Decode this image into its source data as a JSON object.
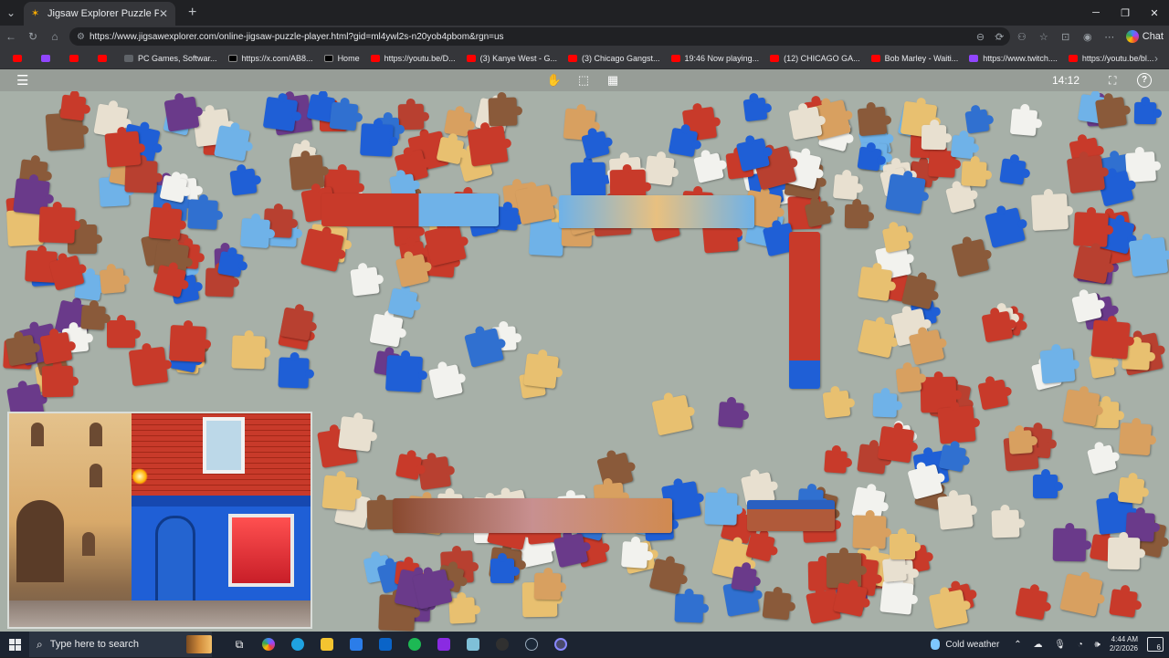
{
  "browser": {
    "tab": {
      "title": "Jigsaw Explorer Puzzle Player",
      "favicon": "puzzle-piece-icon"
    },
    "new_tab": "+",
    "window_controls": [
      "minimize-icon",
      "restore-icon",
      "close-icon"
    ],
    "address": {
      "url": "https://www.jigsawexplorer.com/online-jigsaw-puzzle-player.html?gid=ml4ywl2s-n20yob4pbom&rgn=us",
      "chat_label": "Chat"
    },
    "bookmarks": [
      {
        "label": "",
        "icon": "youtube"
      },
      {
        "label": "",
        "icon": "twitch"
      },
      {
        "label": "",
        "icon": "youtube"
      },
      {
        "label": "",
        "icon": "youtube"
      },
      {
        "label": "PC Games, Softwar...",
        "icon": "generic"
      },
      {
        "label": "https://x.com/AB8...",
        "icon": "x"
      },
      {
        "label": "Home",
        "icon": "x"
      },
      {
        "label": "https://youtu.be/D...",
        "icon": "youtube"
      },
      {
        "label": "(3) Kanye West - G...",
        "icon": "youtube"
      },
      {
        "label": "(3) Chicago Gangst...",
        "icon": "youtube"
      },
      {
        "label": "19:46 Now playing...",
        "icon": "youtube"
      },
      {
        "label": "(12) CHICAGO GA...",
        "icon": "youtube"
      },
      {
        "label": "Bob Marley - Waiti...",
        "icon": "youtube"
      },
      {
        "label": "https://www.twitch....",
        "icon": "twitch"
      },
      {
        "label": "https://youtu.be/bl...",
        "icon": "youtube"
      }
    ]
  },
  "puzzle": {
    "timer": "14:12",
    "toolbar_icons": [
      "menu-icon",
      "hand-pan-icon",
      "select-area-icon",
      "image-preview-icon",
      "fullscreen-icon",
      "help-icon"
    ],
    "help_label": "?",
    "colors": {
      "board": "#a7b0a8",
      "toolbar": "#979d97",
      "brick_red": "#c83a2a",
      "shop_blue": "#1f5fd6",
      "sky_blue": "#6fb2e8",
      "stone_gold": "#e8c070"
    }
  },
  "taskbar": {
    "search_placeholder": "Type here to search",
    "weather": "Cold weather",
    "time": "4:44 AM",
    "date": "2/2/2026",
    "notifications": "6",
    "apps": [
      "task-view",
      "copilot",
      "edge",
      "file-explorer",
      "store",
      "outlook",
      "spotify",
      "winrar",
      "notepad",
      "steam-alt",
      "steam",
      "chrome"
    ]
  }
}
